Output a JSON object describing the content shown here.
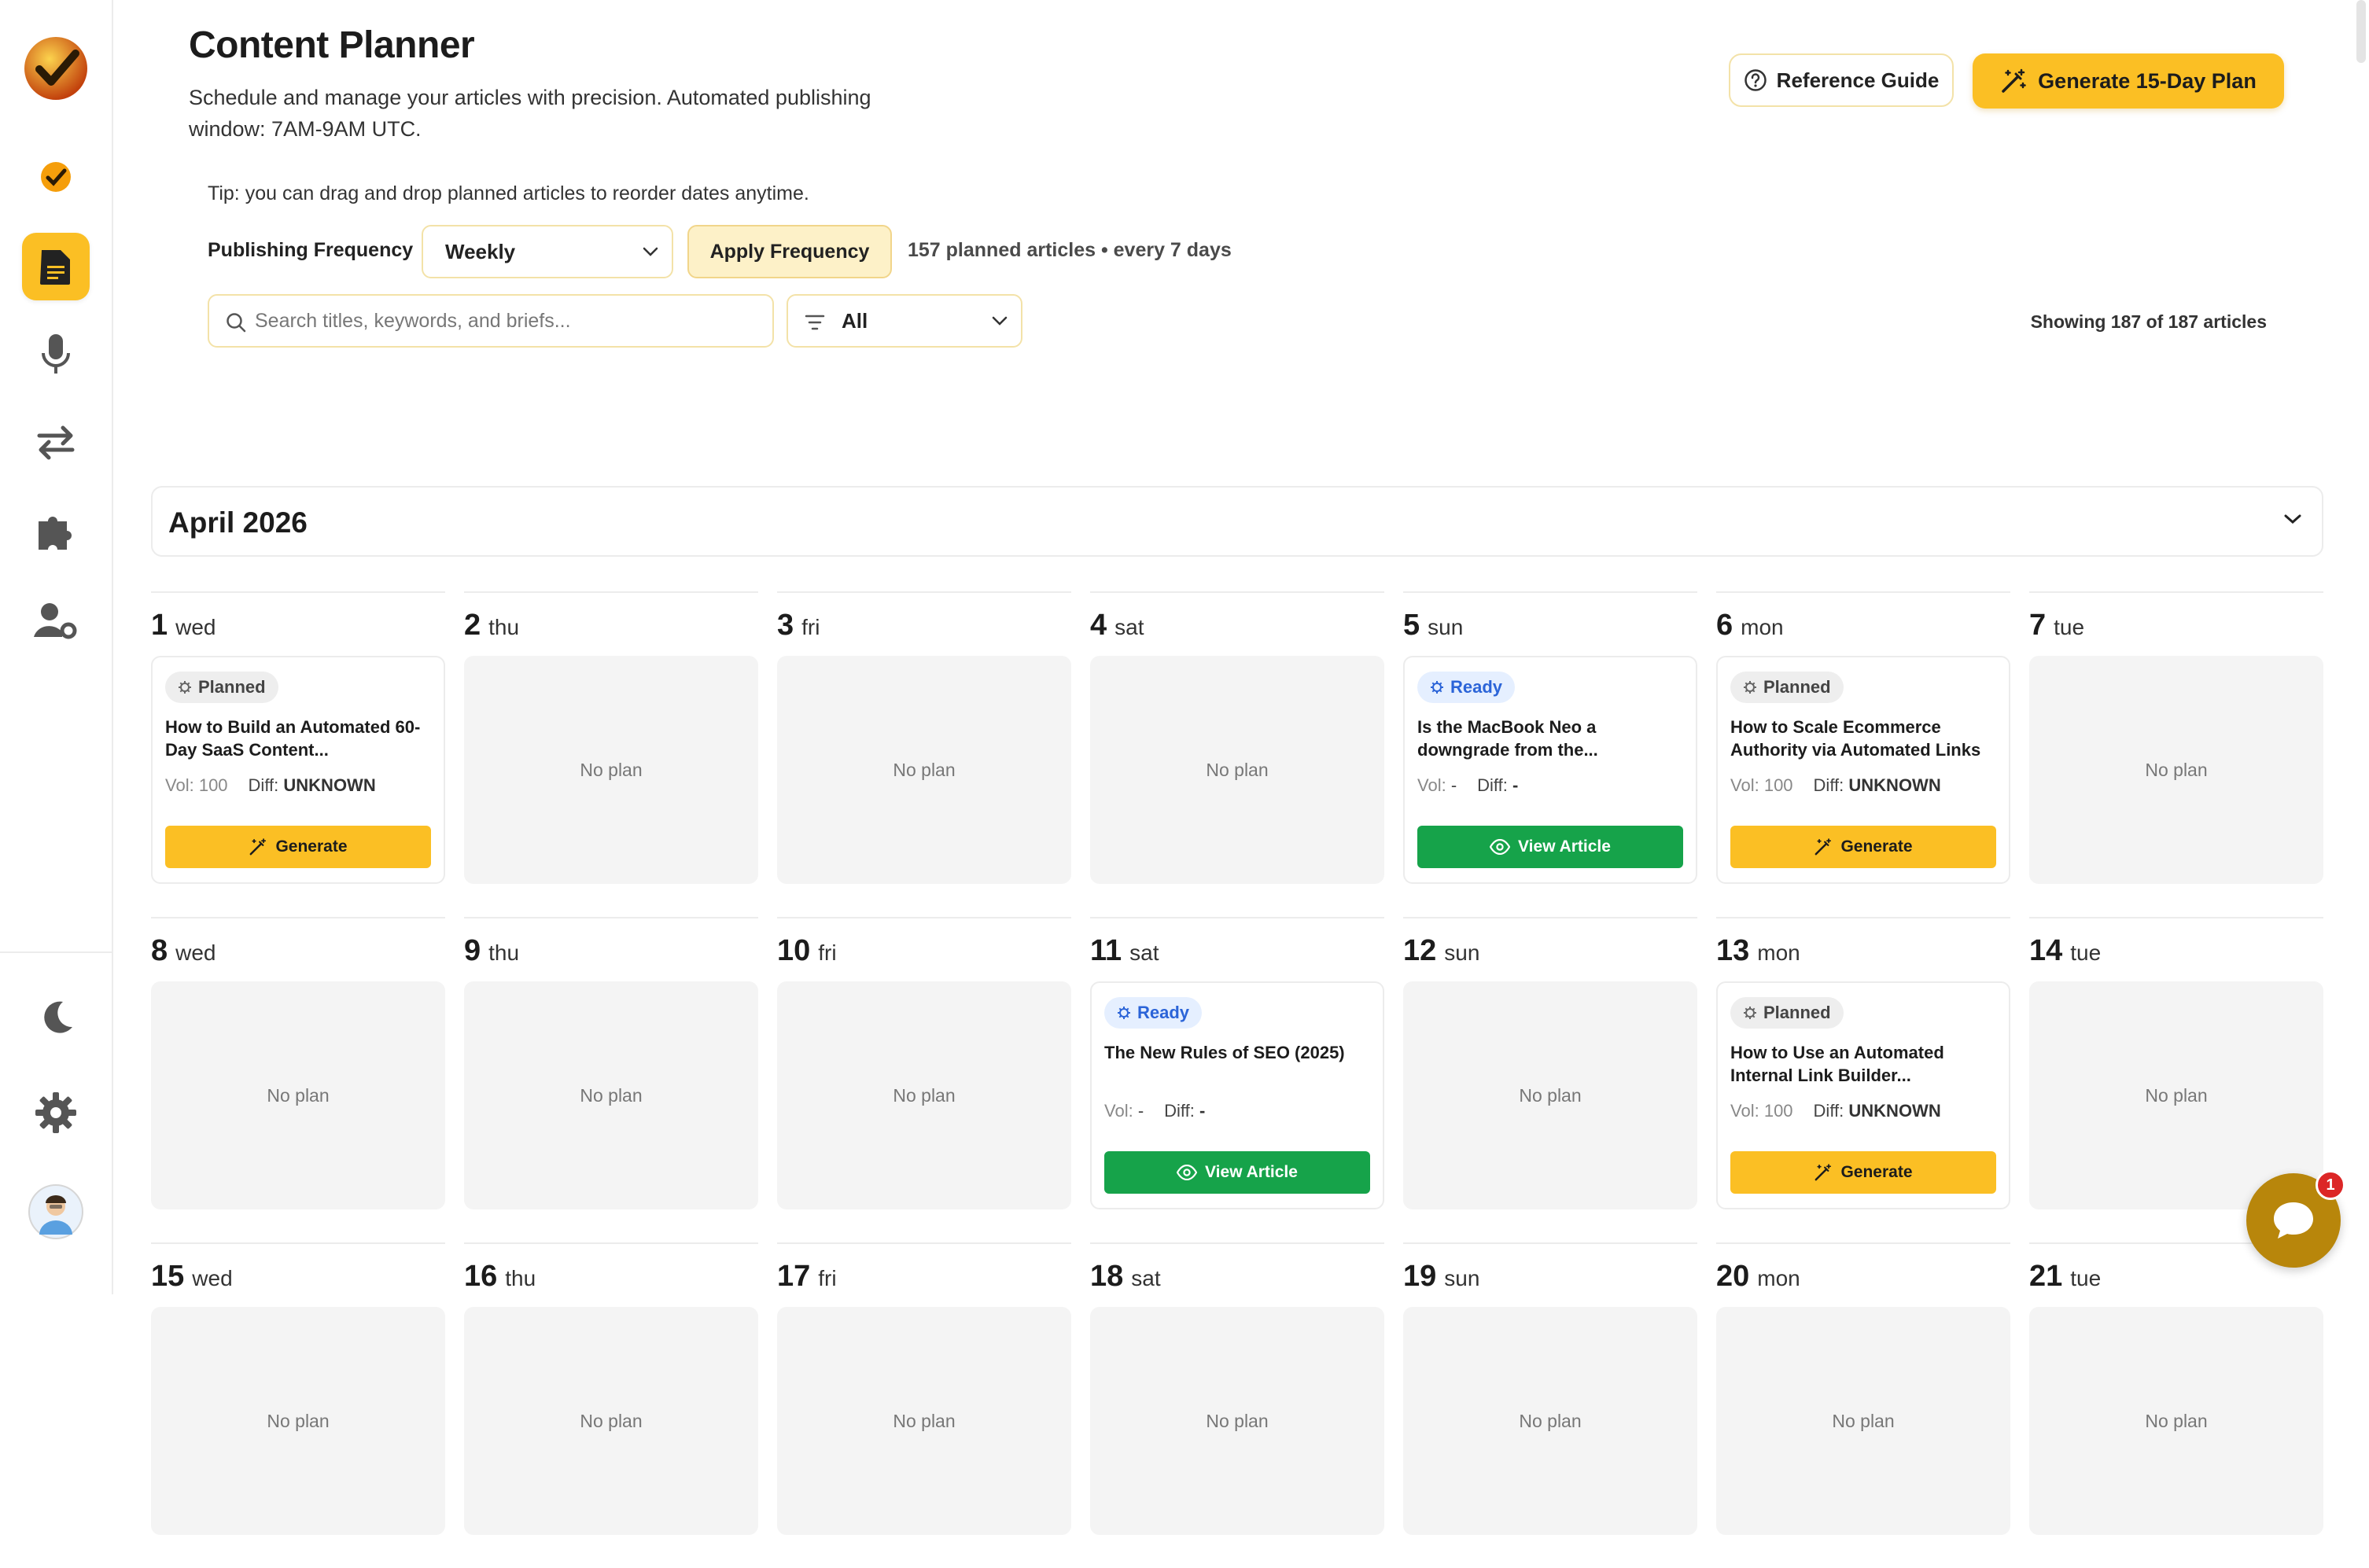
{
  "app": {
    "title": "Content Planner",
    "subtitle": "Schedule and manage your articles with precision. Automated publishing window: 7AM-9AM UTC."
  },
  "header": {
    "reference_label": "Reference Guide",
    "generate_plan_label": "Generate 15-Day Plan"
  },
  "toolbar": {
    "tip": "Tip: you can drag and drop planned articles to reorder dates anytime.",
    "frequency_label": "Publishing Frequency",
    "frequency_value": "Weekly",
    "apply_label": "Apply Frequency",
    "planned_summary": "157 planned articles • every 7 days",
    "search_placeholder": "Search titles, keywords, and briefs...",
    "filter_value": "All",
    "showing_text": "Showing 187 of 187 articles"
  },
  "calendar": {
    "month_label": "April 2026",
    "empty_label": "No plan",
    "generate_label": "Generate",
    "view_label": "View Article",
    "weeks": [
      {
        "days": [
          {
            "num": "1",
            "name": "wed",
            "card": {
              "status": "Planned",
              "title": "How to Build an Automated 60-Day SaaS Content...",
              "vol_label": "Vol:",
              "vol": "100",
              "diff_label": "Diff:",
              "diff": "UNKNOWN",
              "action": "generate"
            }
          },
          {
            "num": "2",
            "name": "thu"
          },
          {
            "num": "3",
            "name": "fri"
          },
          {
            "num": "4",
            "name": "sat"
          },
          {
            "num": "5",
            "name": "sun",
            "card": {
              "status": "Ready",
              "title": "Is the MacBook Neo a downgrade from the...",
              "vol_label": "Vol:",
              "vol": "-",
              "diff_label": "Diff:",
              "diff": "-",
              "action": "view"
            }
          },
          {
            "num": "6",
            "name": "mon",
            "card": {
              "status": "Planned",
              "title": "How to Scale Ecommerce Authority via Automated Links",
              "vol_label": "Vol:",
              "vol": "100",
              "diff_label": "Diff:",
              "diff": "UNKNOWN",
              "action": "generate"
            }
          },
          {
            "num": "7",
            "name": "tue"
          }
        ]
      },
      {
        "days": [
          {
            "num": "8",
            "name": "wed"
          },
          {
            "num": "9",
            "name": "thu"
          },
          {
            "num": "10",
            "name": "fri"
          },
          {
            "num": "11",
            "name": "sat",
            "card": {
              "status": "Ready",
              "title": "The New Rules of SEO (2025)",
              "vol_label": "Vol:",
              "vol": "-",
              "diff_label": "Diff:",
              "diff": "-",
              "action": "view"
            }
          },
          {
            "num": "12",
            "name": "sun"
          },
          {
            "num": "13",
            "name": "mon",
            "card": {
              "status": "Planned",
              "title": "How to Use an Automated Internal Link Builder...",
              "vol_label": "Vol:",
              "vol": "100",
              "diff_label": "Diff:",
              "diff": "UNKNOWN",
              "action": "generate"
            }
          },
          {
            "num": "14",
            "name": "tue"
          }
        ]
      },
      {
        "days": [
          {
            "num": "15",
            "name": "wed"
          },
          {
            "num": "16",
            "name": "thu"
          },
          {
            "num": "17",
            "name": "fri"
          },
          {
            "num": "18",
            "name": "sat"
          },
          {
            "num": "19",
            "name": "sun"
          },
          {
            "num": "20",
            "name": "mon"
          },
          {
            "num": "21",
            "name": "tue"
          }
        ]
      }
    ]
  },
  "chat": {
    "unread_count": "1"
  },
  "colors": {
    "accent": "#fbbf24",
    "ready_blue": "#2b64d8",
    "view_green": "#16a34a",
    "empty_gray": "#f4f4f4"
  },
  "sidebar_icons": [
    "logo-icon",
    "app-icon",
    "document-icon",
    "microphone-icon",
    "swap-arrows-icon",
    "puzzle-icon",
    "user-settings-icon",
    "moon-icon",
    "gear-icon",
    "avatar"
  ]
}
